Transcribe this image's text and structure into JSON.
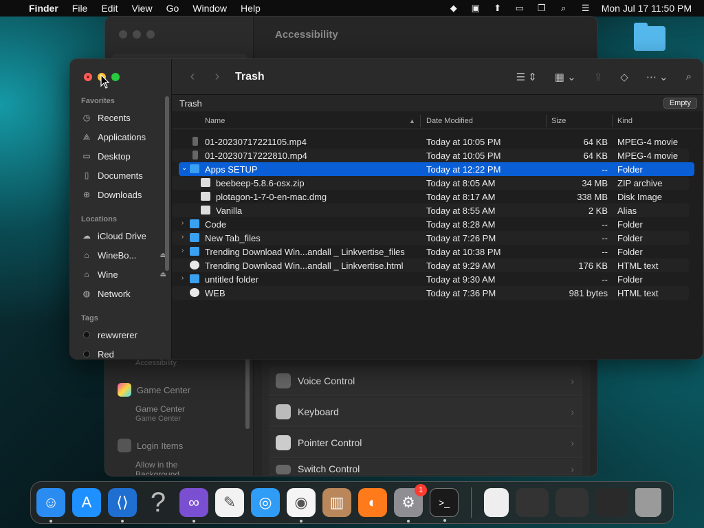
{
  "menubar": {
    "app_name": "Finder",
    "menus": [
      "File",
      "Edit",
      "View",
      "Go",
      "Window",
      "Help"
    ],
    "clock": "Mon Jul 17  11:50 PM"
  },
  "settings_window": {
    "title": "Accessibility",
    "sidebar": {
      "faded_label": "Accessibility",
      "game_center": "Game Center",
      "game_center_sub_title": "Game Center",
      "game_center_sub": "Game Center",
      "login_items": "Login Items",
      "allow_background": "Allow in the Background"
    },
    "rows": [
      "Voice Control",
      "Keyboard",
      "Pointer Control",
      "Switch Control"
    ]
  },
  "finder": {
    "title": "Trash",
    "path_label": "Trash",
    "empty_button": "Empty",
    "sidebar": {
      "favorites_header": "Favorites",
      "favorites": [
        {
          "label": "Recents",
          "icon": "clock-icon"
        },
        {
          "label": "Applications",
          "icon": "applications-icon"
        },
        {
          "label": "Desktop",
          "icon": "desktop-icon"
        },
        {
          "label": "Documents",
          "icon": "document-icon"
        },
        {
          "label": "Downloads",
          "icon": "download-icon"
        }
      ],
      "locations_header": "Locations",
      "locations": [
        {
          "label": "iCloud Drive",
          "icon": "cloud-icon"
        },
        {
          "label": "WineBo...",
          "icon": "drive-icon"
        },
        {
          "label": "Wine",
          "icon": "drive-icon"
        },
        {
          "label": "Network",
          "icon": "globe-icon"
        }
      ],
      "tags_header": "Tags",
      "tags": [
        "rewwrerer",
        "Red"
      ]
    },
    "columns": {
      "name": "Name",
      "date": "Date Modified",
      "size": "Size",
      "kind": "Kind"
    },
    "files": [
      {
        "name": "01-20230717221105.mp4",
        "date": "Today at 10:05 PM",
        "size": "64 KB",
        "kind": "MPEG-4 movie",
        "icon": "movie"
      },
      {
        "name": "01-20230717222810.mp4",
        "date": "Today at 10:05 PM",
        "size": "64 KB",
        "kind": "MPEG-4 movie",
        "icon": "movie"
      },
      {
        "name": "Apps SETUP",
        "date": "Today at 12:22 PM",
        "size": "--",
        "kind": "Folder",
        "icon": "folder"
      },
      {
        "name": "beebeep-5.8.6-osx.zip",
        "date": "Today at 8:05 AM",
        "size": "34 MB",
        "kind": "ZIP archive",
        "icon": "doc"
      },
      {
        "name": "plotagon-1-7-0-en-mac.dmg",
        "date": "Today at 8:17 AM",
        "size": "338 MB",
        "kind": "Disk Image",
        "icon": "doc"
      },
      {
        "name": "Vanilla",
        "date": "Today at 8:55 AM",
        "size": "2 KB",
        "kind": "Alias",
        "icon": "doc"
      },
      {
        "name": "Code",
        "date": "Today at 8:28 AM",
        "size": "--",
        "kind": "Folder",
        "icon": "folder"
      },
      {
        "name": "New Tab_files",
        "date": "Today at 7:26 PM",
        "size": "--",
        "kind": "Folder",
        "icon": "folder"
      },
      {
        "name": "Trending Download Win...andall _ Linkvertise_files",
        "date": "Today at 10:38 PM",
        "size": "--",
        "kind": "Folder",
        "icon": "folder"
      },
      {
        "name": "Trending Download Win...andall _ Linkvertise.html",
        "date": "Today at 9:29 AM",
        "size": "176 KB",
        "kind": "HTML text",
        "icon": "html"
      },
      {
        "name": "untitled folder",
        "date": "Today at 9:30 AM",
        "size": "--",
        "kind": "Folder",
        "icon": "folder"
      },
      {
        "name": "WEB",
        "date": "Today at 7:36 PM",
        "size": "981 bytes",
        "kind": "HTML text",
        "icon": "html"
      }
    ]
  },
  "dock": {
    "apps": [
      {
        "name": "finder-icon",
        "glyph": "☺",
        "bg": "#2a8cf0"
      },
      {
        "name": "app-store-icon",
        "glyph": "A",
        "bg": "#1e90ff"
      },
      {
        "name": "vscode-icon",
        "glyph": "⟨⟩",
        "bg": "#1f6fd1"
      },
      {
        "name": "help-icon",
        "glyph": "?",
        "bg": "transparent"
      },
      {
        "name": "visual-studio-icon",
        "glyph": "∞",
        "bg": "#7b4fd1"
      },
      {
        "name": "textedit-icon",
        "glyph": "✎",
        "bg": "#f2f2f2"
      },
      {
        "name": "safari-icon",
        "glyph": "◎",
        "bg": "#2f9cf5"
      },
      {
        "name": "chrome-icon",
        "glyph": "◉",
        "bg": "#f5f5f5"
      },
      {
        "name": "archive-utility-icon",
        "glyph": "▥",
        "bg": "#b9875a"
      },
      {
        "name": "firefox-icon",
        "glyph": "◐",
        "bg": "#ff7a1a"
      },
      {
        "name": "system-settings-icon",
        "glyph": "⚙",
        "bg": "#8e8e93"
      },
      {
        "name": "terminal-icon",
        "glyph": ">_",
        "bg": "#1a1a1a"
      }
    ],
    "settings_badge": "1"
  }
}
